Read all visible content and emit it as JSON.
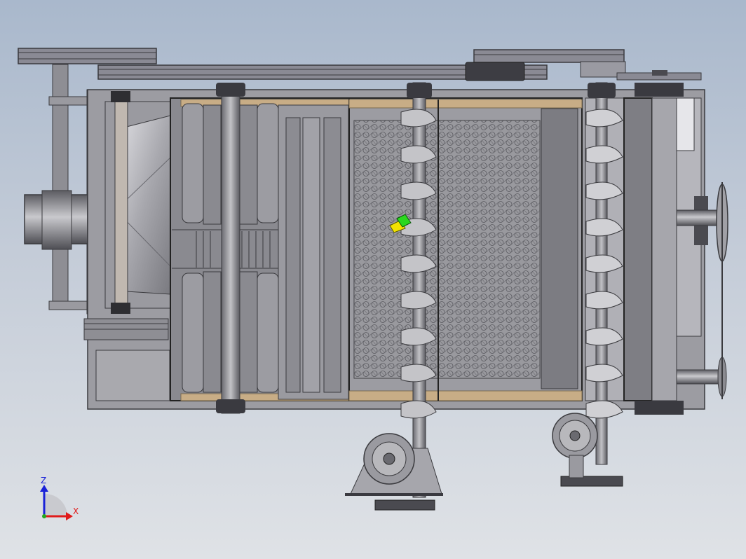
{
  "viewport": {
    "background_top": "#a9b8cc",
    "background_bottom": "#dfe2e6"
  },
  "model": {
    "frame_color": "#3a3a3e",
    "panel_color": "#8c8c92",
    "panel_light": "#b4b4b8",
    "wood_color": "#c8ad86",
    "auger_color": "#7d7d83",
    "belt_color": "#6f6f79"
  },
  "triad": {
    "z_label": "Z",
    "x_label": "X",
    "z_color": "#1a22d8",
    "x_color": "#e01a1a"
  },
  "marker": {
    "icon": "move-handle-icon",
    "colors": [
      "#f2e200",
      "#2bd81f"
    ]
  }
}
